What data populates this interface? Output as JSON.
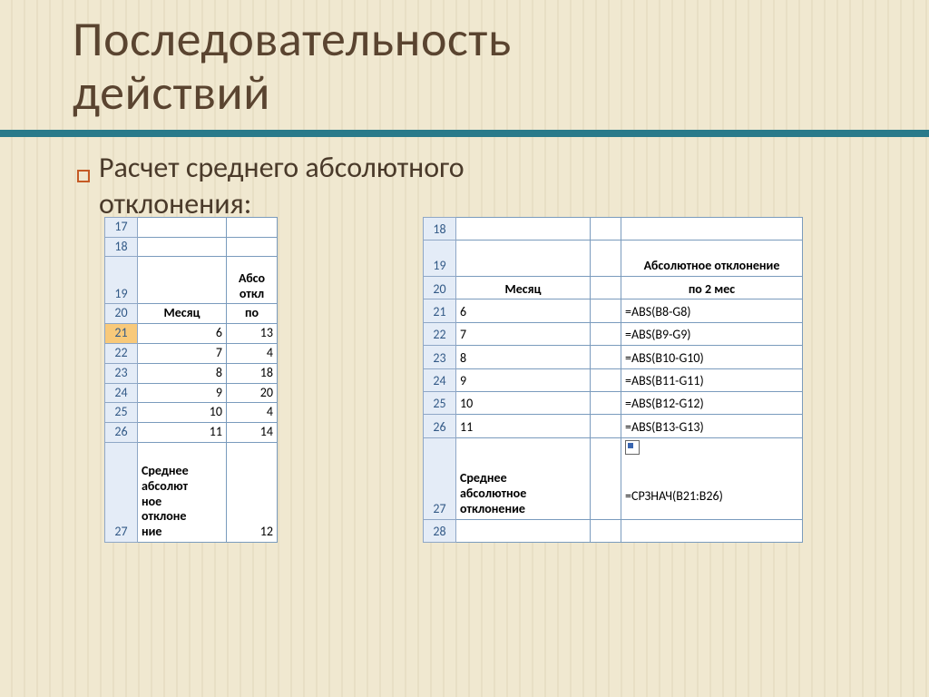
{
  "title_line1": "Последовательность",
  "title_line2": " действий",
  "subtitle_line1": "Расчет среднего абсолютного",
  "subtitle_line2": "отклонения:",
  "table_left": {
    "rows": [
      "17",
      "18",
      "19",
      "20",
      "21",
      "22",
      "23",
      "24",
      "25",
      "26",
      "27"
    ],
    "r19_c2": "Абсо",
    "r19_c2b": "откл",
    "r20_c1": "Месяц",
    "r20_c2": "по",
    "r21_c1": "6",
    "r21_c2": "13",
    "r22_c1": "7",
    "r22_c2": "4",
    "r23_c1": "8",
    "r23_c2": "18",
    "r24_c1": "9",
    "r24_c2": "20",
    "r25_c1": "10",
    "r25_c2": "4",
    "r26_c1": "11",
    "r26_c2": "14",
    "r27_c1_l1": "Среднее",
    "r27_c1_l2": "абсолют",
    "r27_c1_l3": "ное",
    "r27_c1_l4": "отклоне",
    "r27_c1_l5": "ние",
    "r27_c2": "12"
  },
  "table_right": {
    "rows": [
      "18",
      "19",
      "20",
      "21",
      "22",
      "23",
      "24",
      "25",
      "26",
      "27",
      "28"
    ],
    "r19_c3": "Абсолютное отклонение",
    "r20_c1": "Месяц",
    "r20_c3": "по 2 мес",
    "r21_c1": "6",
    "r21_c3": "=ABS(B8-G8)",
    "r22_c1": "7",
    "r22_c3": "=ABS(B9-G9)",
    "r23_c1": "8",
    "r23_c3": "=ABS(B10-G10)",
    "r24_c1": "9",
    "r24_c3": "=ABS(B11-G11)",
    "r25_c1": "10",
    "r25_c3": "=ABS(B12-G12)",
    "r26_c1": "11",
    "r26_c3": "=ABS(B13-G13)",
    "r27_c1_l1": "Среднее",
    "r27_c1_l2": "абсолютное",
    "r27_c1_l3": "отклонение",
    "r27_c3": "=СРЗНАЧ(B21:B26)"
  }
}
